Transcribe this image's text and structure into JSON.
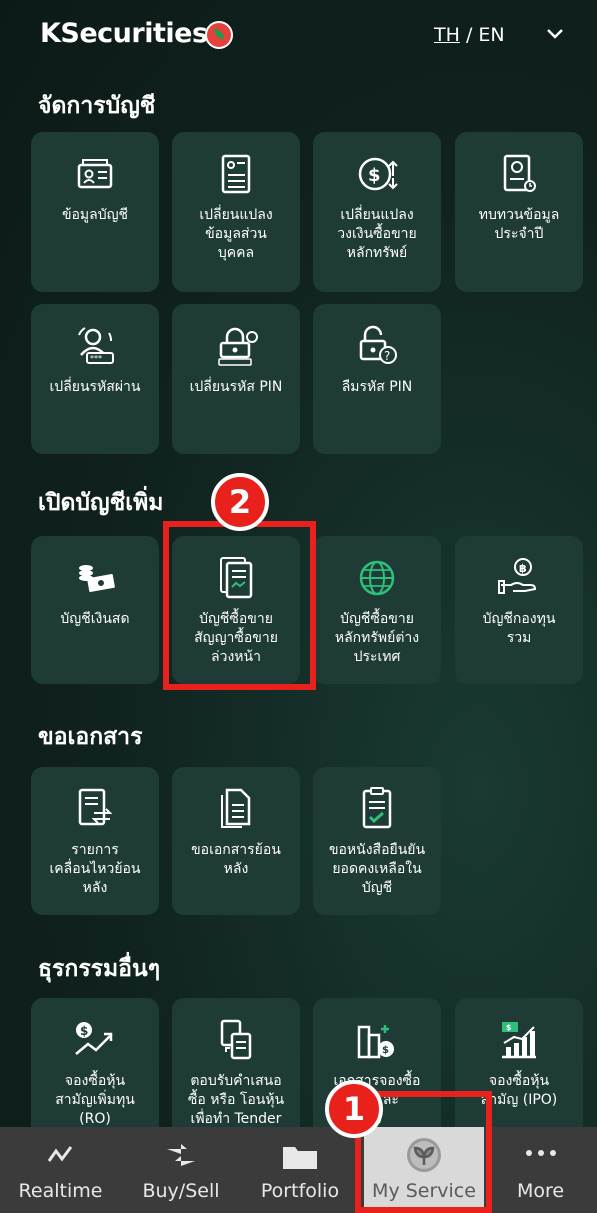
{
  "header": {
    "brand": "KSecurities",
    "lang_th": "TH",
    "lang_sep": "/",
    "lang_en": "EN",
    "logo_icon": "kbank-leaf-icon",
    "menu_icon": "chevron-down-icon"
  },
  "sections": [
    {
      "title": "จัดการบัญชี",
      "items": [
        {
          "label": "ข้อมูลบัญชี",
          "icon": "account-card-icon"
        },
        {
          "label": "เปลี่ยนแปลง\nข้อมูลส่วน\nบุคคล",
          "icon": "personal-document-icon"
        },
        {
          "label": "เปลี่ยนแปลง\nวงเงินซื้อขาย\nหลักทรัพย์",
          "icon": "credit-limit-icon"
        },
        {
          "label": "ทบทวนข้อมูล\nประจำปี",
          "icon": "annual-review-icon"
        },
        {
          "label": "เปลี่ยนรหัสผ่าน",
          "icon": "change-password-icon"
        },
        {
          "label": "เปลี่ยนรหัส PIN",
          "icon": "change-pin-icon"
        },
        {
          "label": "ลืมรหัส PIN",
          "icon": "forgot-pin-icon"
        }
      ]
    },
    {
      "title": "เปิดบัญชีเพิ่ม",
      "items": [
        {
          "label": "บัญชีเงินสด",
          "icon": "cash-account-icon"
        },
        {
          "label": "บัญชีซื้อขาย\nสัญญาซื้อขาย\nล่วงหน้า",
          "icon": "derivatives-contract-icon"
        },
        {
          "label": "บัญชีซื้อขาย\nหลักทรัพย์ต่าง\nประเทศ",
          "icon": "globe-icon"
        },
        {
          "label": "บัญชีกองทุน\nรวม",
          "icon": "mutual-fund-icon"
        }
      ]
    },
    {
      "title": "ขอเอกสาร",
      "items": [
        {
          "label": "รายการ\nเคลื่อนไหวย้อน\nหลัง",
          "icon": "transaction-history-icon"
        },
        {
          "label": "ขอเอกสารย้อน\nหลัง",
          "icon": "document-copy-icon"
        },
        {
          "label": "ขอหนังสือยืนยัน\nยอดคงเหลือใน\nบัญชี",
          "icon": "balance-confirmation-icon"
        }
      ]
    },
    {
      "title": "ธุรกรรมอื่นๆ",
      "items": [
        {
          "label": "จองซื้อหุ้น\nสามัญเพิ่มทุน\n(RO)",
          "icon": "rights-offering-icon"
        },
        {
          "label": "ตอบรับคำเสนอ\nซื้อ หรือ โอนหุ้น\nเพื่อทำ Tender",
          "icon": "tender-offer-icon"
        },
        {
          "label": "เอกสารจองซื้อ\nหุ้นและ\nw",
          "icon": "subscription-document-icon"
        },
        {
          "label": "จองซื้อหุ้น\nสามัญ (IPO)",
          "icon": "ipo-chart-icon"
        }
      ]
    }
  ],
  "callouts": {
    "step1": "1",
    "step2": "2"
  },
  "bottom_nav": [
    {
      "label": "Realtime",
      "icon": "realtime-chart-icon"
    },
    {
      "label": "Buy/Sell",
      "icon": "buy-sell-arrows-icon"
    },
    {
      "label": "Portfolio",
      "icon": "folder-icon"
    },
    {
      "label": "My Service",
      "icon": "my-service-leaf-icon",
      "active": true
    },
    {
      "label": "More",
      "icon": "more-dots-icon"
    }
  ],
  "colors": {
    "background": "#0f1f1c",
    "tile": "#1e3b35",
    "accent_icon": "#ffffff",
    "highlight": "#e8211c",
    "nav_bg": "#3b3b3b",
    "nav_active_bg": "#d9d9d9"
  }
}
